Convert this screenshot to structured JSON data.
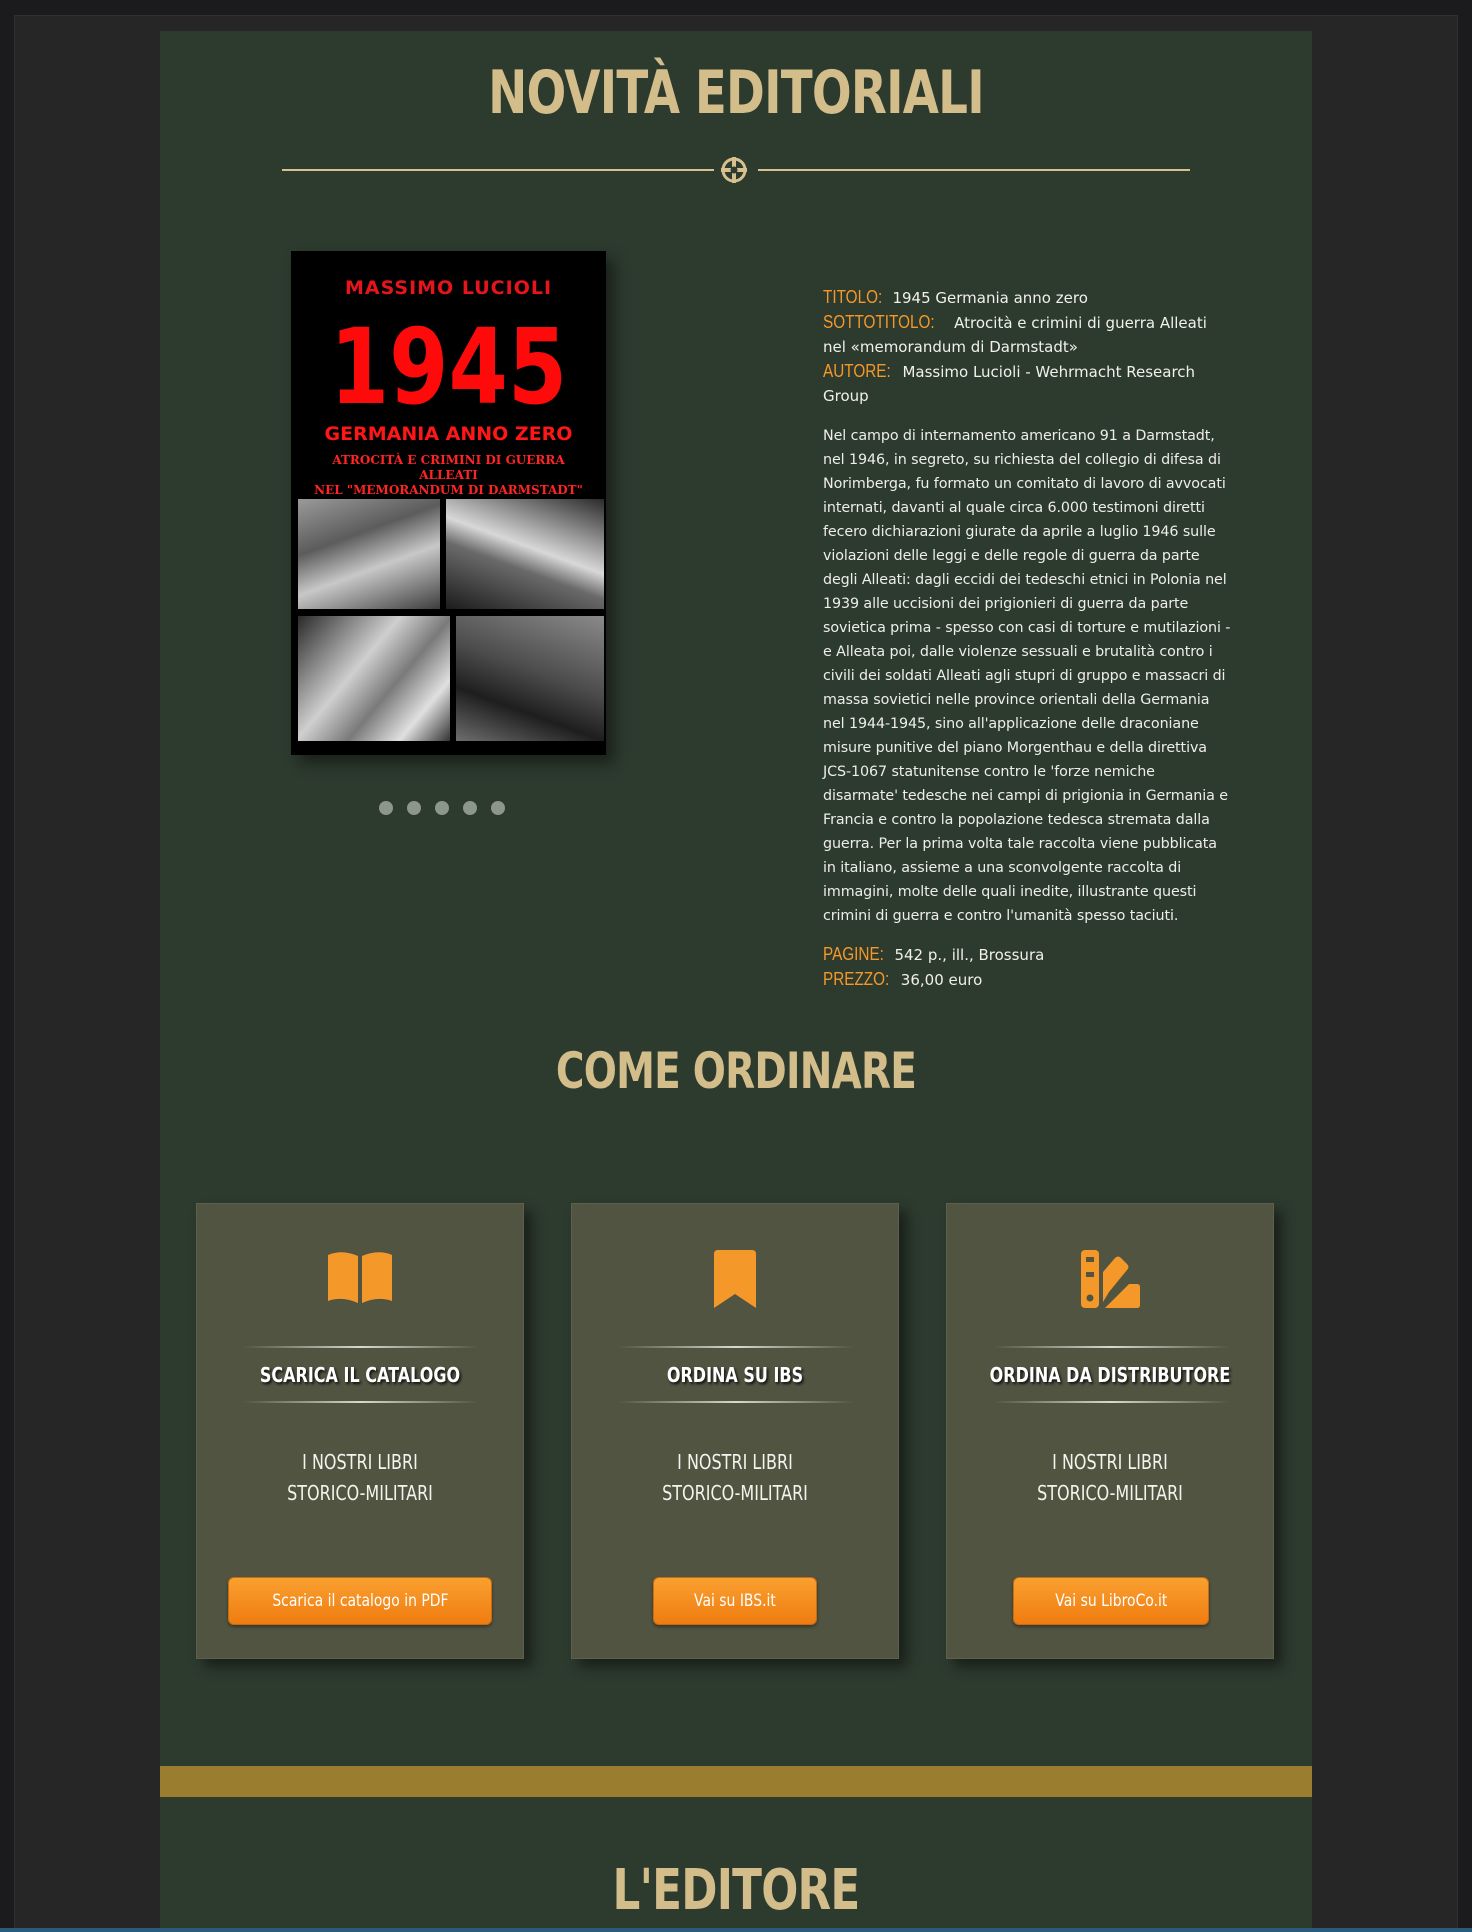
{
  "novita": {
    "heading": "NOVITÀ EDITORIALI",
    "divider_icon": "celtic-cross-emblem-icon",
    "book": {
      "cover": {
        "author": "MASSIMO LUCIOLI",
        "year": "1945",
        "title": "GERMANIA ANNO ZERO",
        "subtitle_line1": "ATROCITÀ E CRIMINI DI GUERRA ALLEATI",
        "subtitle_line2": "NEL \"MEMORANDUM DI DARMSTADT\""
      },
      "carousel_dots": 5,
      "fields": {
        "titolo_label": "TITOLO:",
        "titolo": "1945 Germania anno zero",
        "sottotitolo_label": "SOTTOTITOLO:",
        "sottotitolo": "Atrocità e crimini di guerra Alleati nel «memorandum di Darmstadt»",
        "autore_label": "AUTORE:",
        "autore": "Massimo Lucioli - Wehrmacht Research Group",
        "pagine_label": "PAGINE:",
        "pagine": "542 p., ill., Brossura",
        "prezzo_label": "PREZZO:",
        "prezzo": "36,00 euro"
      },
      "description": "Nel campo di internamento americano 91 a Darmstadt, nel 1946, in segreto, su richiesta del collegio di difesa di Norimberga, fu formato un comitato di lavoro di avvocati internati, davanti al quale circa 6.000 testimoni diretti fecero dichiarazioni giurate da aprile a luglio 1946 sulle violazioni delle leggi e delle regole di guerra da parte degli Alleati: dagli eccidi dei tedeschi etnici in Polonia nel 1939 alle uccisioni dei prigionieri di guerra da parte sovietica prima - spesso con casi di torture e mutilazioni - e Alleata poi, dalle violenze sessuali e brutalità contro i civili dei soldati Alleati agli stupri di gruppo e massacri di massa sovietici nelle province orientali della Germania nel 1944-1945, sino all'applicazione delle draconiane misure punitive del piano Morgenthau e della direttiva JCS-1067 statunitense contro le 'forze nemiche disarmate' tedesche nei campi di prigionia in Germania e Francia e contro la popolazione tedesca stremata dalla guerra. Per la prima volta tale raccolta viene pubblicata in italiano, assieme a una sconvolgente raccolta di immagini, molte delle quali inedite, illustrante questi crimini di guerra e contro l'umanità spesso taciuti."
    }
  },
  "ordinare": {
    "heading": "COME ORDINARE",
    "accent_color": "#f5982a",
    "cards": [
      {
        "icon": "open-book-icon",
        "title": "SCARICA IL CATALOGO",
        "text_line1": "I NOSTRI LIBRI",
        "text_line2": "STORICO-MILITARI",
        "button": "Scarica il catalogo in PDF"
      },
      {
        "icon": "bookmark-icon",
        "title": "ORDINA SU IBS",
        "text_line1": "I NOSTRI LIBRI",
        "text_line2": "STORICO-MILITARI",
        "button": "Vai su IBS.it"
      },
      {
        "icon": "swatchbook-icon",
        "title": "ORDINA DA DISTRIBUTORE",
        "text_line1": "I NOSTRI LIBRI",
        "text_line2": "STORICO-MILITARI",
        "button": "Vai su LibroCo.it"
      }
    ]
  },
  "editore": {
    "heading": "L'EDITORE"
  }
}
